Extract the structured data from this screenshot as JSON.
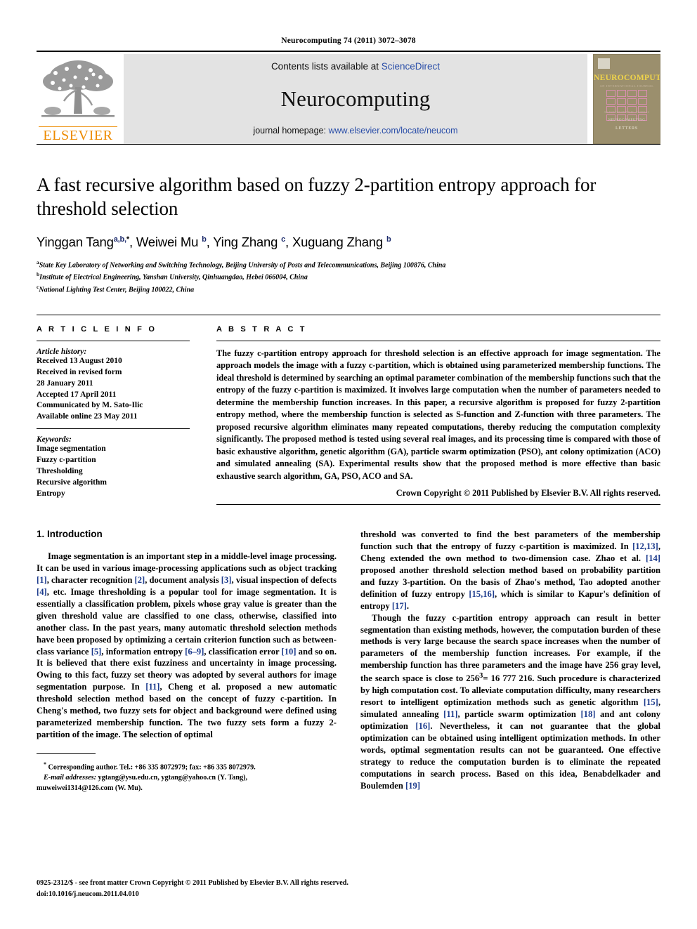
{
  "running_head": "Neurocomputing 74 (2011) 3072–3078",
  "banner": {
    "publisher_logo_text": "ELSEVIER",
    "contents_prefix": "Contents lists available at ",
    "contents_link": "ScienceDirect",
    "journal_name": "Neurocomputing",
    "homepage_prefix": "journal homepage: ",
    "homepage_link": "www.elsevier.com/locate/neucom",
    "cover": {
      "title": "NEUROCOMPUTING",
      "subtitle": "AN INTERNATIONAL JOURNAL",
      "section_label": "AN INTERNATIONAL JOURNAL",
      "footer_line1": "NEUROCOMPUTING",
      "footer_line2": "LETTERS"
    }
  },
  "article": {
    "title": "A fast recursive algorithm based on fuzzy 2-partition entropy approach for threshold selection",
    "authors": [
      {
        "name": "Yinggan Tang",
        "sup": "a,b,",
        "star": "*"
      },
      {
        "name": "Weiwei Mu",
        "sup": "b",
        "star": ""
      },
      {
        "name": "Ying Zhang",
        "sup": "c",
        "star": ""
      },
      {
        "name": "Xuguang Zhang",
        "sup": "b",
        "star": ""
      }
    ],
    "affiliations": [
      {
        "mark": "a",
        "text": "State Key Laboratory of Networking and Switching Technology, Beijing University of Posts and Telecommunications, Beijing 100876, China"
      },
      {
        "mark": "b",
        "text": "Institute of Electrical Engineering, Yanshan University, Qinhuangdao, Hebei 066004, China"
      },
      {
        "mark": "c",
        "text": "National Lighting Test Center, Beijing 100022, China"
      }
    ]
  },
  "article_info": {
    "heading": "A R T I C L E  I N F O",
    "history_label": "Article history:",
    "history": [
      "Received 13 August 2010",
      "Received in revised form",
      "28 January 2011",
      "Accepted 17 April 2011",
      "Communicated by M. Sato-Ilic",
      "Available online 23 May 2011"
    ],
    "keywords_label": "Keywords:",
    "keywords": [
      "Image segmentation",
      "Fuzzy c-partition",
      "Thresholding",
      "Recursive algorithm",
      "Entropy"
    ]
  },
  "abstract": {
    "heading": "A B S T R A C T",
    "text": "The fuzzy c-partition entropy approach for threshold selection is an effective approach for image segmentation. The approach models the image with a fuzzy c-partition, which is obtained using parameterized membership functions. The ideal threshold is determined by searching an optimal parameter combination of the membership functions such that the entropy of the fuzzy c-partition is maximized. It involves large computation when the number of parameters needed to determine the membership function increases. In this paper, a recursive algorithm is proposed for fuzzy 2-partition entropy method, where the membership function is selected as S-function and Z-function with three parameters. The proposed recursive algorithm eliminates many repeated computations, thereby reducing the computation complexity significantly. The proposed method is tested using several real images, and its processing time is compared with those of basic exhaustive algorithm, genetic algorithm (GA), particle swarm optimization (PSO), ant colony optimization (ACO) and simulated annealing (SA). Experimental results show that the proposed method is more effective than basic exhaustive search algorithm, GA, PSO, ACO and SA.",
    "copyright": "Crown Copyright © 2011 Published by Elsevier B.V. All rights reserved."
  },
  "introduction": {
    "heading": "1.  Introduction",
    "left_paragraph_1_a": "Image segmentation is an important step in a middle-level image processing. It can be used in various image-processing applications such as object tracking ",
    "left_paragraph_1_b": ", character recognition ",
    "left_paragraph_1_c": ", document analysis ",
    "left_paragraph_1_d": ", visual inspection of defects ",
    "left_paragraph_1_e": ", etc. Image thresholding is a popular tool for image segmentation. It is essentially a classification problem, pixels whose gray value is greater than the given threshold value are classified to one class, otherwise, classified into another class. In the past years, many automatic threshold selection methods have been proposed by optimizing a certain criterion function such as between-class variance ",
    "left_paragraph_1_f": ", information entropy ",
    "left_paragraph_1_g": ", classification error ",
    "left_paragraph_1_h": " and so on. It is believed that there exist fuzziness and uncertainty in image processing. Owing to this fact, fuzzy set theory was adopted by several authors for image segmentation purpose. In ",
    "left_paragraph_1_i": ", Cheng et al. proposed a new automatic threshold selection method based on the concept of fuzzy c-partition. In Cheng's method, two fuzzy sets for object and background were defined using parameterized membership function. The two fuzzy sets form a fuzzy 2-partition of the image. The selection of optimal",
    "right_paragraph_1_a": "threshold was converted to find the best parameters of the membership function such that the entropy of fuzzy c-partition is maximized. In ",
    "right_paragraph_1_b": ", Cheng extended the own method to two-dimension case. Zhao et al. ",
    "right_paragraph_1_c": " proposed another threshold selection method based on probability partition and fuzzy 3-partition. On the basis of Zhao's method, Tao adopted another definition of fuzzy entropy ",
    "right_paragraph_1_d": ", which is similar to Kapur's definition of entropy ",
    "right_paragraph_1_e": ".",
    "right_paragraph_2_a": "Though the fuzzy c-partition entropy approach can result in better segmentation than existing methods, however, the computation burden of these methods is very large because the search space increases when the number of parameters of the membership function increases. For example, if the membership function has three parameters and the image have 256 gray level, the search space is close to 256",
    "right_paragraph_2_exp": "3",
    "right_paragraph_2_b": "= 16 777 216. Such procedure is characterized by high computation cost. To alleviate computation difficulty, many researchers resort to intelligent optimization methods such as genetic algorithm ",
    "right_paragraph_2_c": ", simulated annealing ",
    "right_paragraph_2_d": ", particle swarm optimization ",
    "right_paragraph_2_e": " and ant colony optimization ",
    "right_paragraph_2_f": ". Nevertheless, it can not guarantee that the global optimization can be obtained using intelligent optimization methods. In other words, optimal segmentation results can not be guaranteed. One effective strategy to reduce the computation burden is to eliminate the repeated computations in search process. Based on this idea, Benabdelkader and Boulemden ",
    "right_paragraph_2_g": "",
    "refs": {
      "r1": "[1]",
      "r2": "[2]",
      "r3": "[3]",
      "r4": "[4]",
      "r5": "[5]",
      "r69": "[6–9]",
      "r10": "[10]",
      "r11": "[11]",
      "r1213": "[12,13]",
      "r14": "[14]",
      "r1516": "[15,16]",
      "r17": "[17]",
      "r15": "[15]",
      "r11b": "[11]",
      "r18": "[18]",
      "r16": "[16]",
      "r19": "[19]"
    }
  },
  "footnote": {
    "corresponding": "Corresponding author. Tel.: +86 335 8072979; fax: +86 335 8072979.",
    "email_label": "E-mail addresses:",
    "email_line1": " ygtang@ysu.edu.cn, ygtang@yahoo.cn (Y. Tang),",
    "email_line2": "muweiwei1314@126.com (W. Mu)."
  },
  "page_footer": {
    "line1": "0925-2312/$ - see front matter Crown Copyright © 2011 Published by Elsevier B.V. All rights reserved.",
    "line2": "doi:10.1016/j.neucom.2011.04.010"
  }
}
